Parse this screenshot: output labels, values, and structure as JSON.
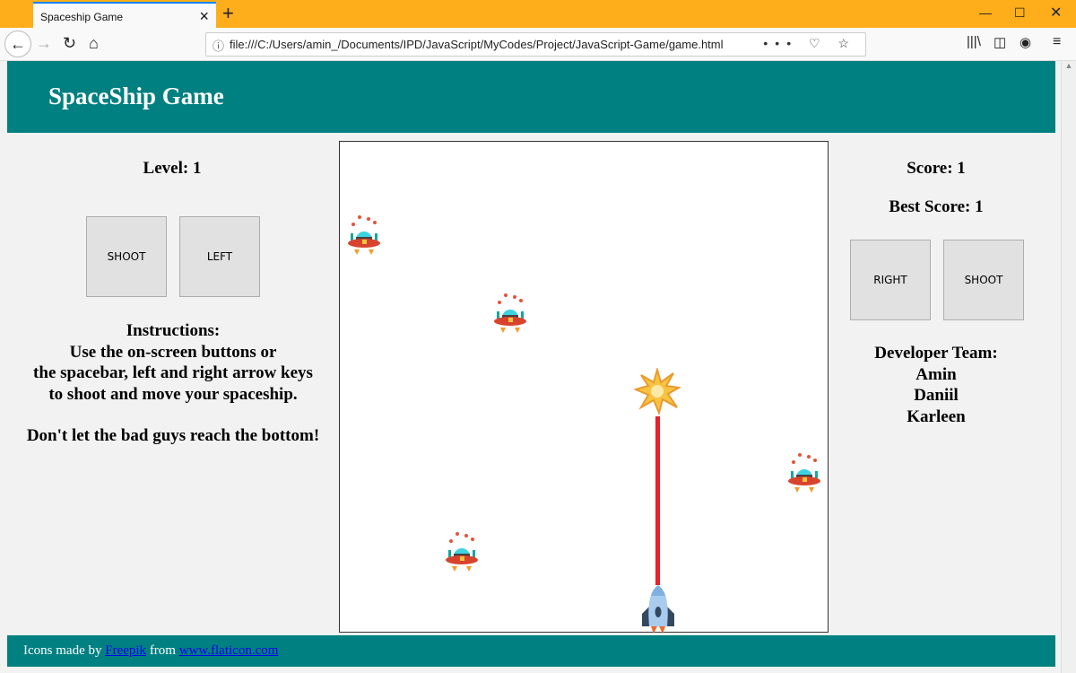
{
  "browser": {
    "tab_title": "Spaceship Game",
    "url": "file:///C:/Users/amin_/Documents/IPD/JavaScript/MyCodes/Project/JavaScript-Game/game.html"
  },
  "header": {
    "title": "SpaceShip Game"
  },
  "left": {
    "level_label": "Level: 1",
    "shoot": "SHOOT",
    "left": "LEFT",
    "instructions": [
      "Instructions:",
      "Use the on-screen buttons or",
      "the spacebar, left and right arrow keys",
      "to shoot and move your spaceship."
    ],
    "warning": "Don't let the bad guys reach the bottom!"
  },
  "right": {
    "score": "Score: 1",
    "best": "Best Score: 1",
    "right": "RIGHT",
    "shoot": "SHOOT",
    "team_title": "Developer Team:",
    "team": [
      "Amin",
      "Daniil",
      "Karleen"
    ]
  },
  "footer": {
    "prefix": "Icons made by ",
    "link1": "Freepik",
    "middle": " from ",
    "link2": "www.flaticon.com"
  },
  "colors": {
    "brand": "#008080",
    "laser": "#e8202a",
    "browser_bar": "#fdae1a"
  }
}
